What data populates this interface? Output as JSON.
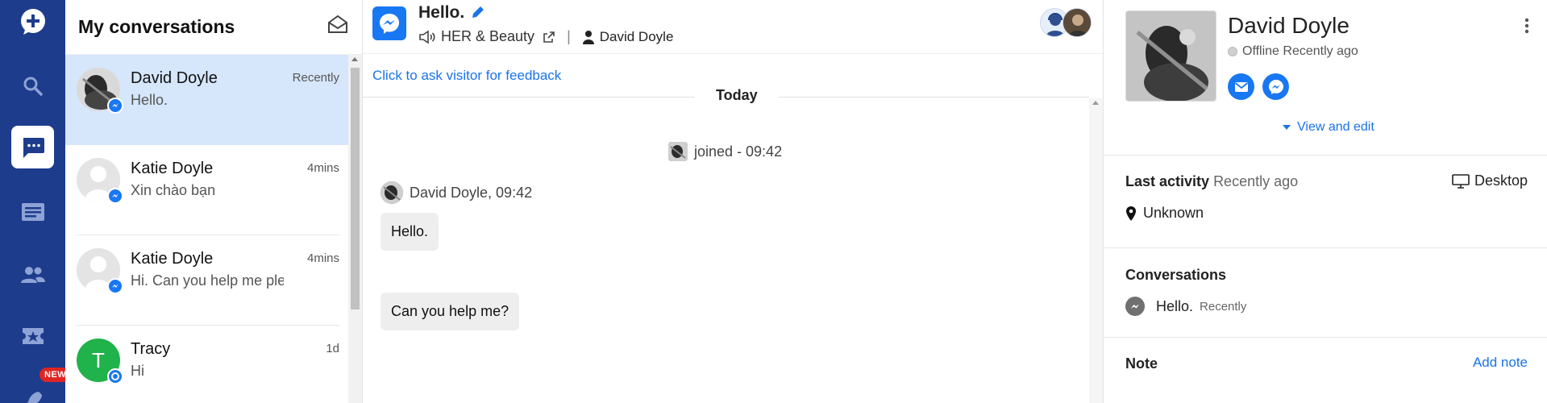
{
  "rail": {
    "new_badge": "NEW"
  },
  "conversations": {
    "title": "My conversations",
    "items": [
      {
        "name": "David Doyle",
        "time": "Recently",
        "preview": "Hello."
      },
      {
        "name": "Katie Doyle",
        "time": "4mins",
        "preview": "Xin chào bạn"
      },
      {
        "name": "Katie Doyle",
        "time": "4mins",
        "preview": "Hi. Can you help me ple"
      },
      {
        "name": "Tracy",
        "time": "1d",
        "preview": "Hi",
        "initial": "T"
      }
    ]
  },
  "chat": {
    "title": "Hello.",
    "page_name": "HER & Beauty",
    "separator": "|",
    "agent": "David Doyle",
    "feedback_link": "Click to ask visitor for feedback",
    "day_label": "Today",
    "joined_text": "joined - 09:42",
    "sender_line": "David Doyle, 09:42",
    "messages": [
      "Hello.",
      "Can you help me?"
    ]
  },
  "profile": {
    "name": "David Doyle",
    "status": "Offline Recently ago",
    "view_edit": "View and edit",
    "last_activity_label": "Last activity",
    "last_activity_value": "Recently ago",
    "device": "Desktop",
    "location": "Unknown",
    "conversations_label": "Conversations",
    "conversation_title": "Hello.",
    "conversation_time": "Recently",
    "note_label": "Note",
    "add_note": "Add note"
  },
  "colors": {
    "rail": "#1d3c8c",
    "messenger": "#1877f2",
    "link": "#1a73e8",
    "active_row": "#d6e6fb",
    "tracy_avatar": "#20b24b"
  }
}
